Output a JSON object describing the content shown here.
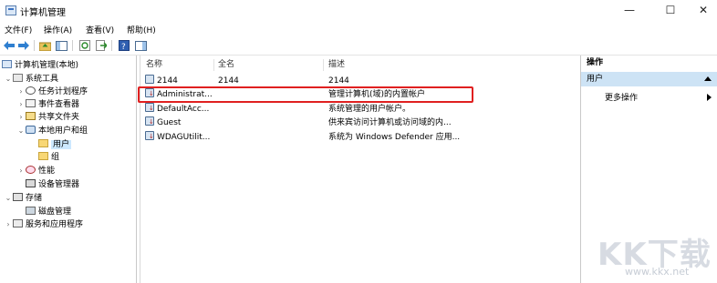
{
  "window": {
    "title": "计算机管理",
    "minimize": "—",
    "maximize": "☐",
    "close": "✕"
  },
  "menu": [
    "文件(F)",
    "操作(A)",
    "查看(V)",
    "帮助(H)"
  ],
  "toolbar": {
    "icons": [
      "back-icon",
      "forward-icon",
      "up-folder-icon",
      "show-tree-icon",
      "refresh-icon",
      "export-list-icon",
      "help-icon",
      "show-action-pane-icon"
    ]
  },
  "tree": {
    "root": "计算机管理(本地)",
    "system_tools": "系统工具",
    "task_scheduler": "任务计划程序",
    "event_viewer": "事件查看器",
    "shared_folders": "共享文件夹",
    "local_users_groups": "本地用户和组",
    "users": "用户",
    "groups": "组",
    "performance": "性能",
    "device_manager": "设备管理器",
    "storage": "存储",
    "disk_management": "磁盘管理",
    "services_apps": "服务和应用程序"
  },
  "list": {
    "columns": [
      "名称",
      "全名",
      "描述"
    ],
    "rows": [
      {
        "name": "2144",
        "fullname": "2144",
        "description": "2144",
        "disabled": false
      },
      {
        "name": "Administrat...",
        "fullname": "",
        "description": "管理计算机(域)的内置帐户",
        "disabled": true
      },
      {
        "name": "DefaultAcc...",
        "fullname": "",
        "description": "系统管理的用户帐户。",
        "disabled": true
      },
      {
        "name": "Guest",
        "fullname": "",
        "description": "供来宾访问计算机或访问域的内...",
        "disabled": true
      },
      {
        "name": "WDAGUtilit...",
        "fullname": "",
        "description": "系统为 Windows Defender 应用...",
        "disabled": true
      }
    ]
  },
  "actions": {
    "header": "操作",
    "section": "用户",
    "more": "更多操作"
  },
  "watermark": {
    "big": "KK下载",
    "small": "www.kkx.net"
  },
  "colors": {
    "highlight": "#e02020",
    "selection": "#cce8ff",
    "action_section": "#cde3f5"
  }
}
